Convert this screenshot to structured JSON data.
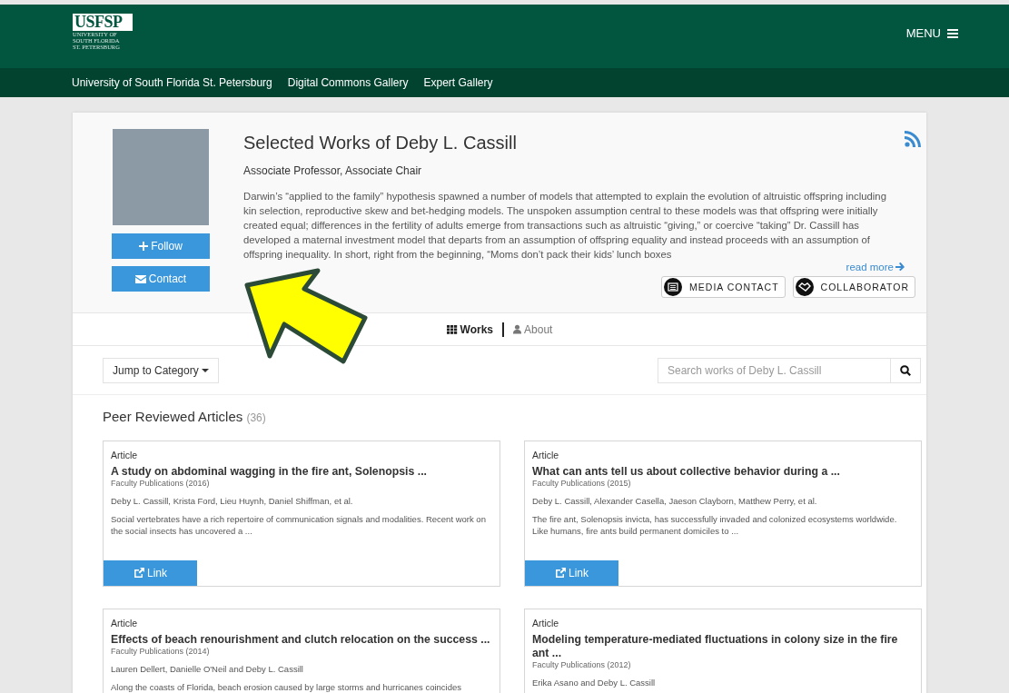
{
  "header": {
    "logo": {
      "wordmark": "USFSP",
      "lines": [
        "UNIVERSITY OF",
        "SOUTH FLORIDA",
        "ST. PETERSBURG"
      ]
    },
    "menu_label": "MENU"
  },
  "nav": {
    "links": [
      "University of South Florida St. Petersburg",
      "Digital Commons Gallery",
      "Expert Gallery"
    ]
  },
  "profile": {
    "title": "Selected Works of Deby L. Cassill",
    "position": "Associate Professor, Associate Chair",
    "bio": "Darwin’s “applied to the family” hypothesis spawned a number of models that attempted to explain the evolution of altruistic offspring including kin selection, reproductive skew and bet-hedging models. The unspoken assumption central to these models was that offspring were initially created equal; differences in the fertility of adults emerge from transactions such as altruistic “giving,” or coercive “taking” Dr. Cassill has developed a maternal investment model that departs from an assumption of offspring equality and instead proceeds with an assumption of offspring inequality. In short, right from the beginning, “Moms don’t pack their kids’ lunch boxes",
    "read_more": "read more",
    "follow_button": "Follow",
    "contact_button": "Contact",
    "badges": [
      {
        "label": "MEDIA CONTACT",
        "kind": "media"
      },
      {
        "label": "COLLABORATOR",
        "kind": "collaborator"
      }
    ]
  },
  "tabs": [
    {
      "label": "Works",
      "selected": true,
      "kind": "works"
    },
    {
      "label": "About",
      "selected": false,
      "kind": "about"
    }
  ],
  "toolbar": {
    "jump_button": "Jump to Category",
    "search": {
      "placeholder": "Search works of Deby L. Cassill"
    }
  },
  "section": {
    "title": "Peer Reviewed Articles",
    "count": "(36)"
  },
  "works": [
    {
      "type": "Article",
      "title": "A study on abdominal wagging in the fire ant, Solenopsis ...",
      "source": "Faculty Publications (2016)",
      "authors": "Deby L. Cassill, Krista Ford, Lieu Huynh, Daniel Shiffman, et al.",
      "abstract": "Social vertebrates have a rich repertoire of communication signals and modalities. Recent work on the social insects has uncovered a ...",
      "link_label": "Link"
    },
    {
      "type": "Article",
      "title": "What can ants tell us about collective behavior during a ...",
      "source": "Faculty Publications (2015)",
      "authors": "Deby L. Cassill, Alexander Casella, Jaeson Clayborn, Matthew Perry, et al.",
      "abstract": "The fire ant, Solenopsis invicta, has successfully invaded and colonized ecosystems worldwide. Like humans, fire ants build permanent domiciles to ...",
      "link_label": "Link"
    },
    {
      "type": "Article",
      "title": "Effects of beach renourishment and clutch relocation on the success ...",
      "source": "Faculty Publications (2014)",
      "authors": "Lauren Dellert, Danielle O'Neil and Deby L. Cassill",
      "abstract": "Along the coasts of Florida, beach erosion caused by large storms and hurricanes coincides"
    },
    {
      "type": "Article",
      "title": "Modeling temperature-mediated fluctuations in colony size in the fire ant ...",
      "source": "Faculty Publications (2012)",
      "authors": "Erika Asano and Deby L. Cassill"
    }
  ]
}
